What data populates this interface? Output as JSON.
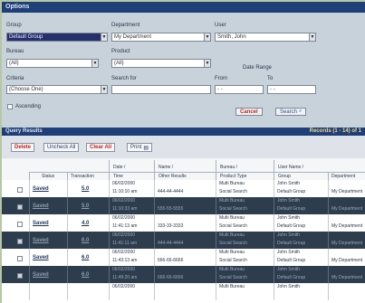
{
  "panel": {
    "title": "Options",
    "group_label": "Group",
    "group_value": "Default Group",
    "department_label": "Department",
    "department_value": "My Department",
    "user_label": "User",
    "user_value": "Smith, John",
    "bureau_label": "Bureau",
    "bureau_value": "(All)",
    "product_label": "Product",
    "product_value": "(All)",
    "date_range_label": "Date Range",
    "criteria_label": "Criteria",
    "criteria_value": "(Choose One)",
    "search_for_label": "Search for",
    "from_label": "From",
    "from_value": "- -",
    "to_label": "To",
    "to_value": "- -",
    "ascending_label": "Ascending",
    "cancel_label": "Cancel",
    "search_label": "Search"
  },
  "results": {
    "title": "Query Results",
    "count": "Records (1 - 14) of 1"
  },
  "toolbar": {
    "delete": "Delete",
    "uncheck_all": "Uncheck All",
    "clear_all": "Clear All",
    "print": "Print"
  },
  "table": {
    "headers": {
      "status": "Status",
      "transaction": "Transaction",
      "date": "Date /",
      "time": "Time",
      "name": "Name /",
      "other_results": "Other Results",
      "bureau": "Bureau /",
      "product_type": "Product Type",
      "user_name": "User Name /",
      "group": "Group",
      "department": "Department"
    },
    "rows": [
      {
        "status": "Saved",
        "transaction": "5.0",
        "date": "06/02/2000",
        "time": "11:10:10 am",
        "other": "444-44-4444",
        "bureau": "Multi Bureau",
        "product": "Social Search",
        "user": "John Smith",
        "group": "Default Group",
        "dept": "My Department",
        "style": "light"
      },
      {
        "status": "Saved",
        "transaction": "5.0",
        "date": "06/02/2000",
        "time": "11:10:33 am",
        "other": "555-55-5555",
        "bureau": "Multi Bureau",
        "product": "Social Search",
        "user": "John Smith",
        "group": "Default Group",
        "dept": "My Department",
        "style": "dark"
      },
      {
        "status": "Saved",
        "transaction": "4.0",
        "date": "06/02/2000",
        "time": "11:41:13 am",
        "other": "333-33-3333",
        "bureau": "Multi Bureau",
        "product": "Social Search",
        "user": "John Smith",
        "group": "Default Group",
        "dept": "My Department",
        "style": "light"
      },
      {
        "status": "Saved",
        "transaction": "6.0",
        "date": "06/02/2000",
        "time": "11:41:11 am",
        "other": "444-44-4444",
        "bureau": "Multi Bureau",
        "product": "Social Search",
        "user": "John Smith",
        "group": "Default Group",
        "dept": "My Department",
        "style": "dark"
      },
      {
        "status": "Saved",
        "transaction": "6.0",
        "date": "06/02/2000",
        "time": "11:43:13 am",
        "other": "666-66-6666",
        "bureau": "Multi Bureau",
        "product": "Social Search",
        "user": "John Smith",
        "group": "Default Group",
        "dept": "My Department",
        "style": "light"
      },
      {
        "status": "Saved",
        "transaction": "6.0",
        "date": "06/02/2000",
        "time": "11:49:20 am",
        "other": "666-66-6666",
        "bureau": "Multi Bureau",
        "product": "Social Search",
        "user": "John Smith",
        "group": "Default Group",
        "dept": "My Department",
        "style": "dark"
      },
      {
        "status": "",
        "transaction": "",
        "date": "06/02/2000",
        "time": "",
        "other": "",
        "bureau": "Multi Bureau",
        "product": "",
        "user": "John Smith",
        "group": "",
        "dept": "",
        "style": "light"
      }
    ]
  },
  "colors": {
    "background": "#b7c6a3",
    "title_bar": "#1f3f78",
    "panel": "#c8d2db",
    "selected_field": "#27306f",
    "dark_row": "#2e3d4e",
    "cancel_text": "#c0271e"
  },
  "icons": {
    "dropdown": "chevron-down-icon",
    "search": "magnifier-icon",
    "print": "printer-icon"
  }
}
